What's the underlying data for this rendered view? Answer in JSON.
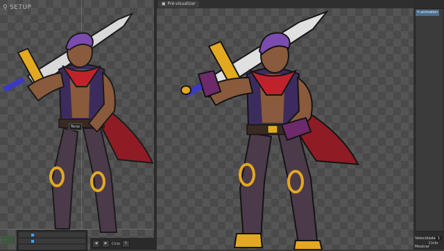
{
  "left_view": {
    "mode_label": "SETUP"
  },
  "tooltip": {
    "text": "Torso"
  },
  "preview": {
    "tab_label": "Pré-visualizar"
  },
  "side_panel": {
    "tab_label": "animation",
    "speed_label": "Velocidade",
    "speed_value": "1",
    "loop_label": "Ciclo",
    "mode_label": "Mostrar"
  },
  "playback": {
    "label": "Ciclo"
  },
  "colors": {
    "hair": "#7b4bb0",
    "skin": "#8a5a3c",
    "scarf": "#c0222b",
    "vest": "#3c2c5e",
    "pants": "#4b3a4a",
    "gold": "#e2a920",
    "blade": "#d8d8d8"
  }
}
